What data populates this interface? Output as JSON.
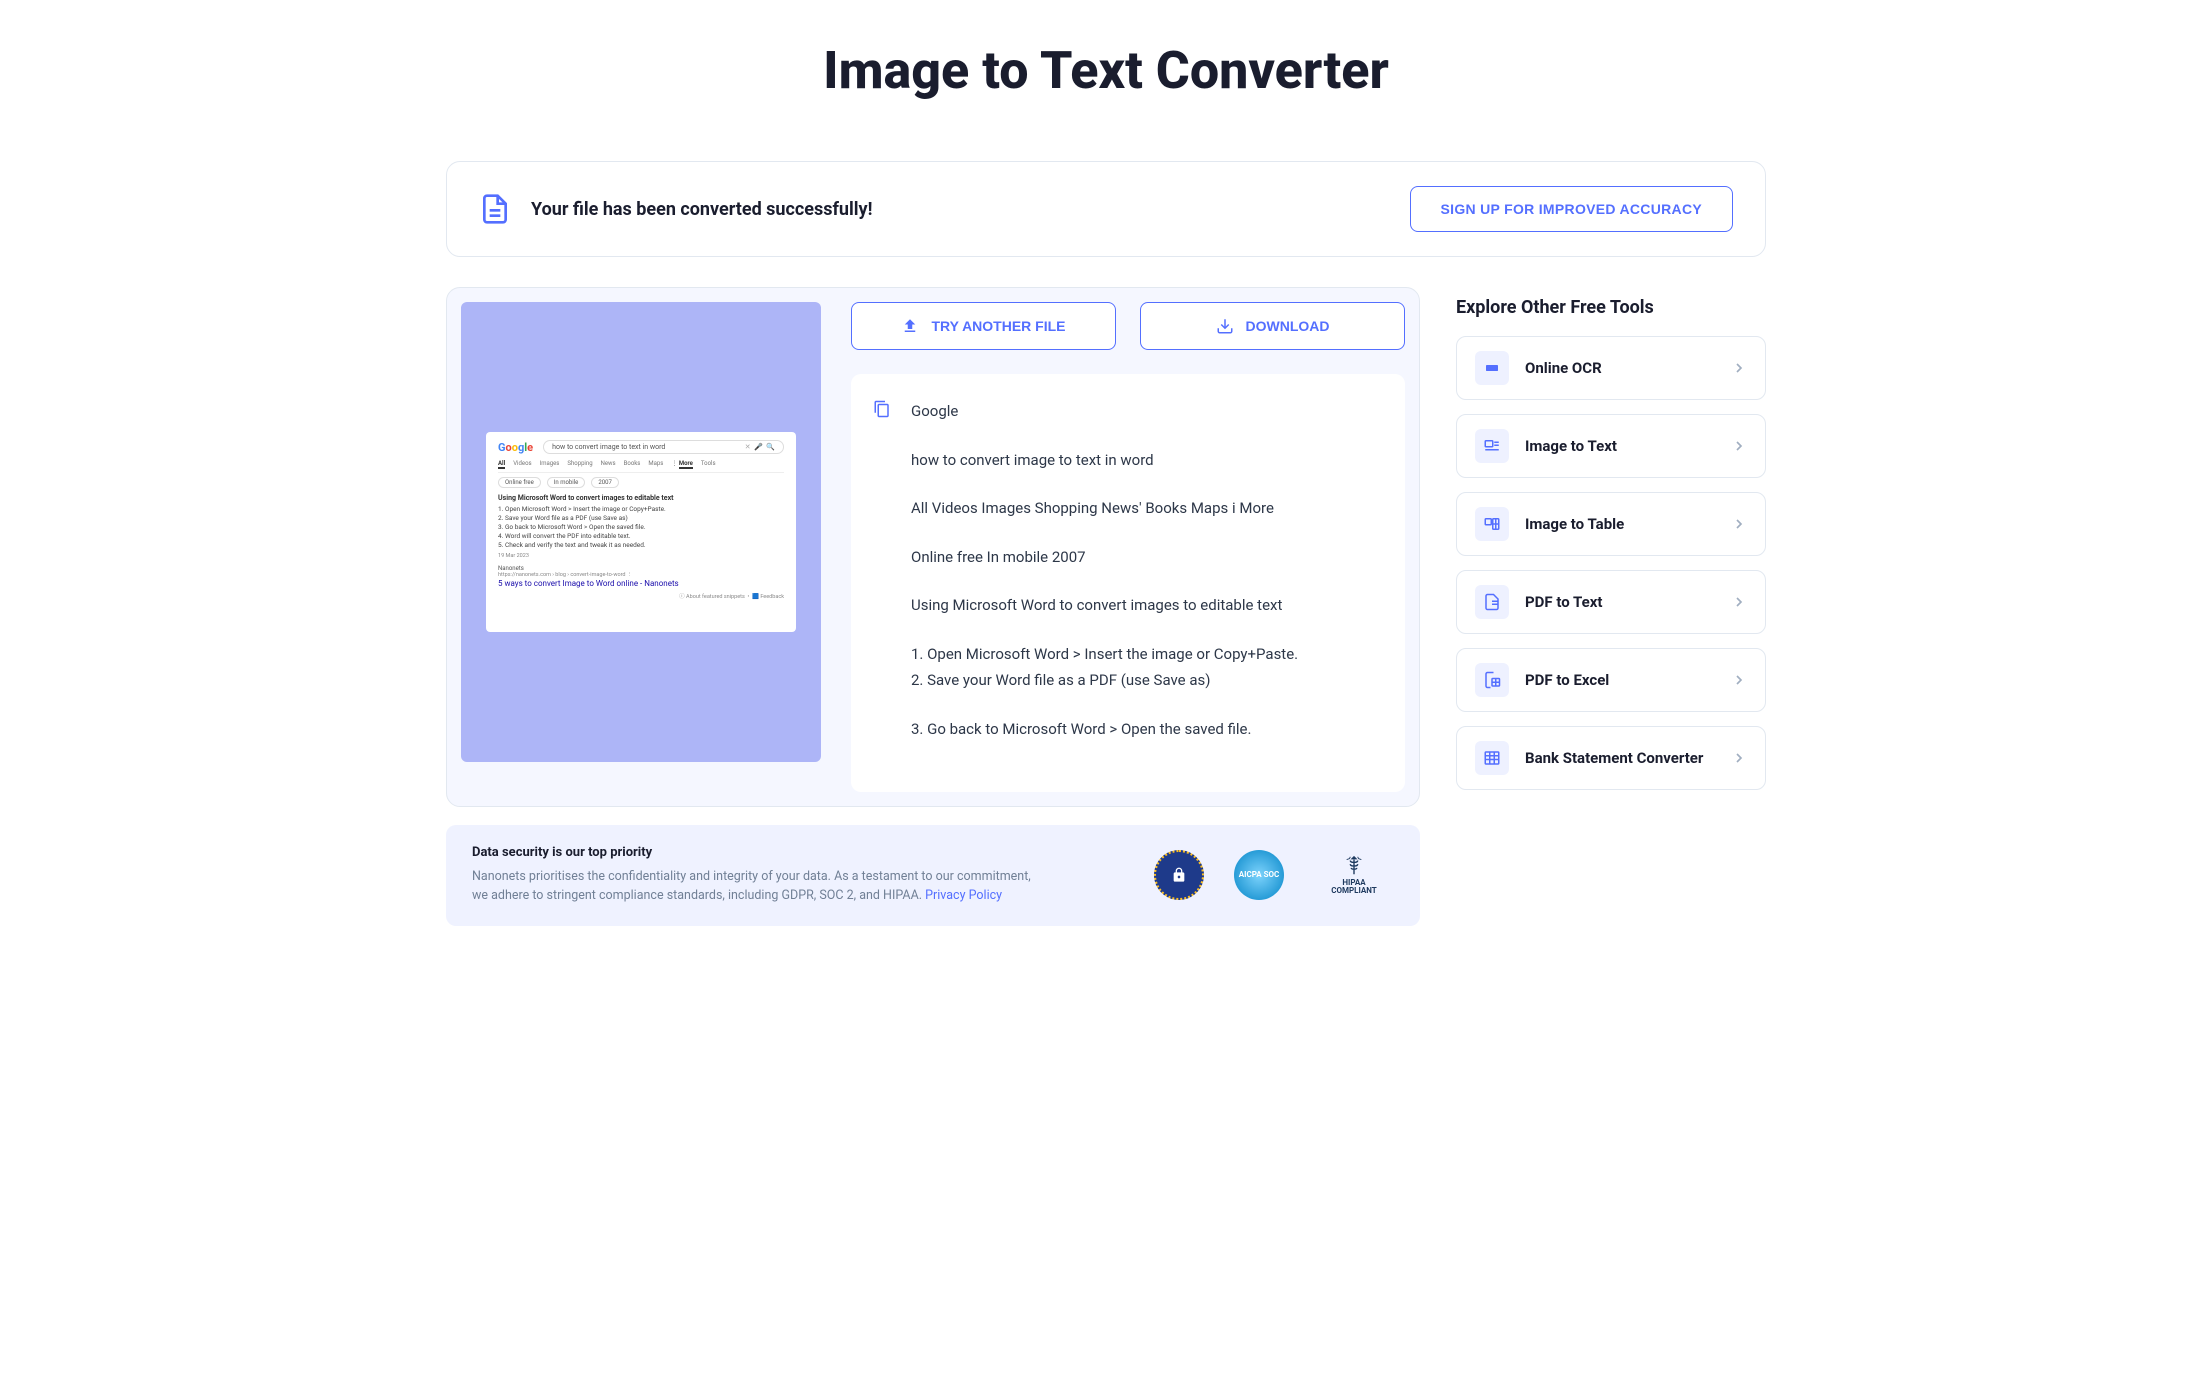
{
  "title": "Image to Text Converter",
  "success": {
    "message": "Your file has been converted successfully!",
    "signup_label": "SIGN UP FOR IMPROVED ACCURACY"
  },
  "actions": {
    "try_another": "TRY ANOTHER FILE",
    "download": "DOWNLOAD"
  },
  "preview": {
    "search_query": "how to convert image to text in word",
    "tabs": [
      "All",
      "Videos",
      "Images",
      "Shopping",
      "News",
      "Books",
      "Maps",
      "More"
    ],
    "tools_label": "Tools",
    "filters": [
      "Online free",
      "In mobile",
      "2007"
    ],
    "snippet_heading": "Using Microsoft Word to convert images to editable text",
    "snippet_items": [
      "1. Open Microsoft Word > Insert the image or Copy+Paste.",
      "2. Save your Word file as a PDF (use Save as)",
      "3. Go back to Microsoft Word > Open the saved file.",
      "4. Word will convert the PDF into editable text.",
      "5. Check and verify the text and tweak it as needed."
    ],
    "snippet_date": "19 Mar 2023",
    "result_source": "Nanonets",
    "result_url": "https://nanonets.com › blog › convert-image-to-word",
    "result_title": "5 ways to convert Image to Word online - Nanonets",
    "footer_about": "About featured snippets",
    "footer_feedback": "Feedback"
  },
  "output": {
    "lines": [
      "Google",
      "how to convert image to text in word",
      "All Videos Images Shopping News' Books Maps i More",
      "Online free In mobile 2007",
      "Using Microsoft Word to convert images to editable text",
      "1. Open Microsoft Word > Insert the image or Copy+Paste.",
      "2. Save your Word file as a PDF (use Save as)",
      "3. Go back to Microsoft Word > Open the saved file."
    ]
  },
  "security": {
    "heading": "Data security is our top priority",
    "body": "Nanonets prioritises the confidentiality and integrity of your data. As a testament to our commitment, we adhere to stringent compliance standards, including GDPR, SOC 2, and HIPAA. ",
    "link": "Privacy Policy",
    "badges": {
      "soc": "AICPA SOC",
      "hipaa_l1": "HIPAA",
      "hipaa_l2": "COMPLIANT"
    }
  },
  "sidebar": {
    "title": "Explore Other Free Tools",
    "tools": [
      {
        "id": "online-ocr",
        "label": "Online OCR"
      },
      {
        "id": "image-to-text",
        "label": "Image to Text"
      },
      {
        "id": "image-to-table",
        "label": "Image to Table"
      },
      {
        "id": "pdf-to-text",
        "label": "PDF to Text"
      },
      {
        "id": "pdf-to-excel",
        "label": "PDF to Excel"
      },
      {
        "id": "bank-statement",
        "label": "Bank Statement Converter"
      }
    ]
  }
}
